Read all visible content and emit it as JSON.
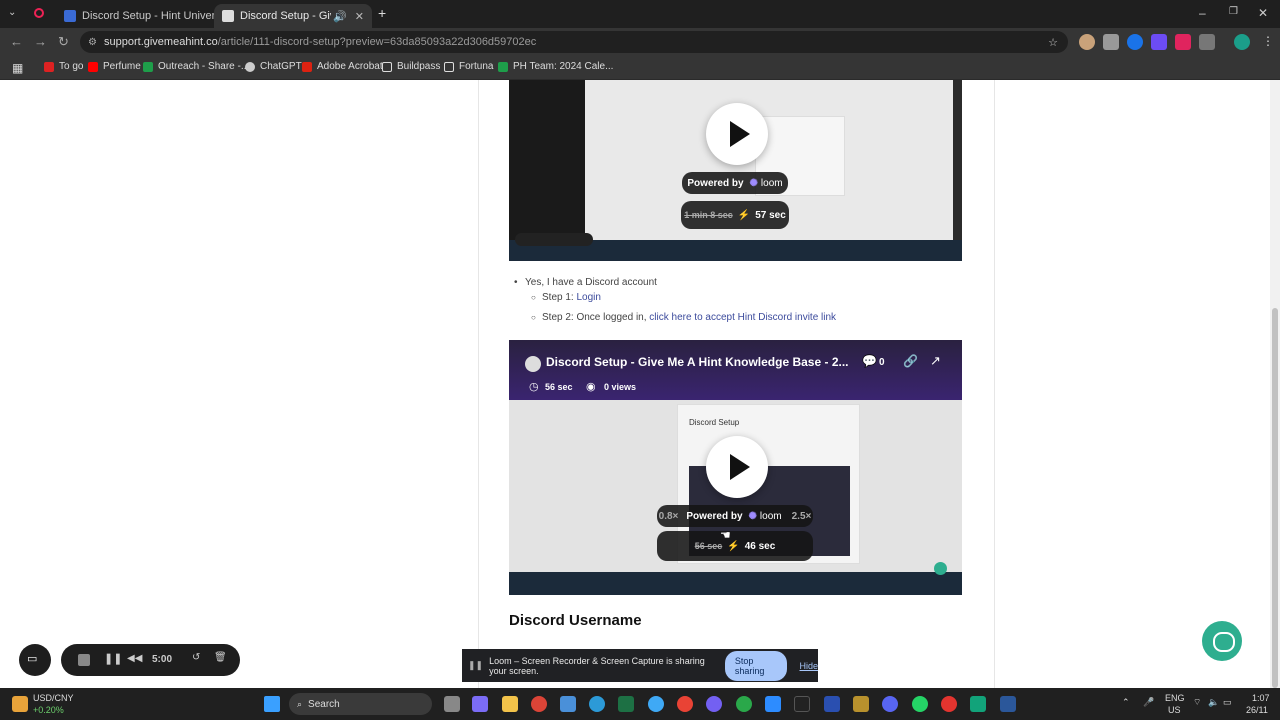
{
  "tabs": [
    {
      "title": "Discord Setup - Hint University",
      "active": false
    },
    {
      "title": "Discord Setup - Give Me A Hi...",
      "active": true
    }
  ],
  "omnibox": {
    "domain": "support.givemeahint.co",
    "path": "/article/111-discord-setup?preview=63da85093a22d306d59702ec"
  },
  "bookmarks": [
    "To go",
    "Perfume",
    "Outreach - Share -...",
    "ChatGPT",
    "Adobe Acrobat",
    "Buildpass",
    "Fortuna",
    "PH Team: 2024 Cale..."
  ],
  "video1": {
    "powered_by": "Powered by",
    "brand": "loom",
    "old_time": "1 min 8 sec",
    "new_time": "57 sec"
  },
  "bullets": {
    "item1": "Yes, I have a Discord account",
    "step1_prefix": "Step 1: ",
    "step1_link": "Login",
    "step2_prefix": "Step 2: Once logged in, ",
    "step2_link": "click here to accept Hint Discord invite link"
  },
  "video2": {
    "title": "Discord Setup - Give Me A Hint Knowledge Base - 2...",
    "comments": "0",
    "duration": "56 sec",
    "views": "0 views",
    "powered_by": "Powered by",
    "brand": "loom",
    "speed_low": "0.8×",
    "speed_high": "2.5×",
    "old_time": "56 sec",
    "new_time": "46 sec",
    "inner_title": "Discord Setup"
  },
  "heading": "Discord Username",
  "loom_timer": "5:00",
  "share_bar": {
    "text": "Loom – Screen Recorder & Screen Capture is sharing your screen.",
    "stop": "Stop sharing",
    "hide": "Hide"
  },
  "taskbar": {
    "currency": "USD/CNY",
    "change": "+0.20%",
    "search": "Search",
    "lang1": "ENG",
    "lang2": "US",
    "time": "1:07",
    "date": "26/11"
  }
}
